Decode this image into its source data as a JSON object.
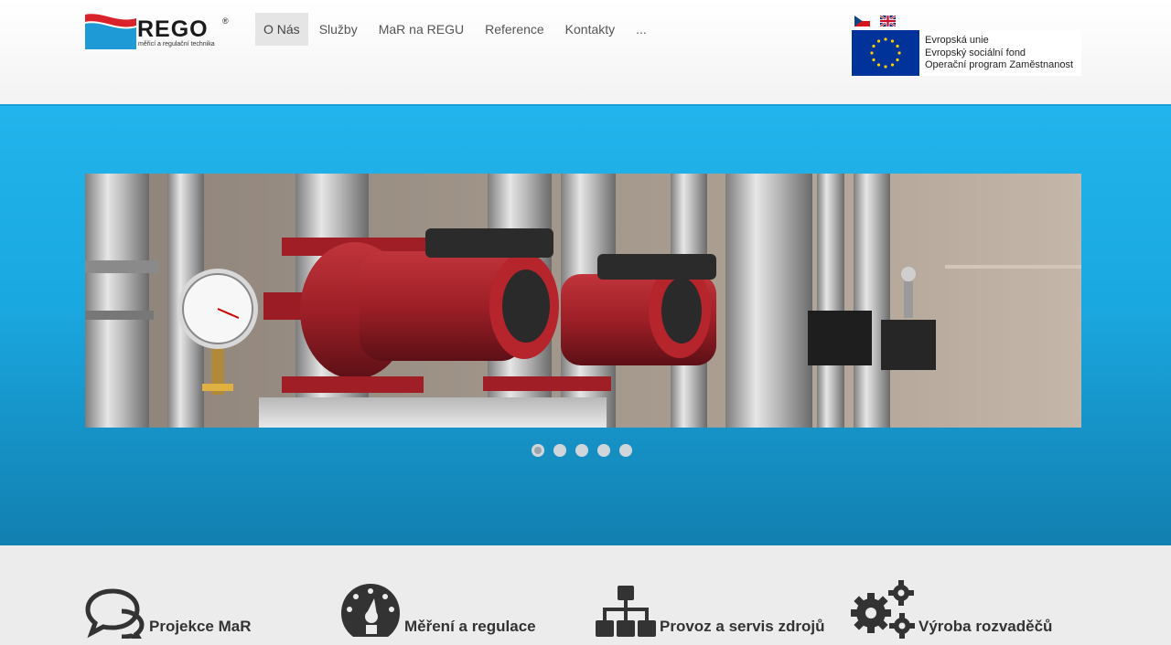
{
  "brand": {
    "name": "REGO",
    "registered": "®",
    "tagline": "měřicí a regulační technika",
    "colors": {
      "red": "#d9222a",
      "blue": "#1e9ad6"
    }
  },
  "nav": {
    "items": [
      {
        "label": "O Nás",
        "active": true
      },
      {
        "label": "Služby"
      },
      {
        "label": "MaR na REGU"
      },
      {
        "label": "Reference"
      },
      {
        "label": "Kontakty"
      },
      {
        "label": "..."
      }
    ]
  },
  "languages": [
    {
      "code": "cs",
      "icon": "czech-flag-icon"
    },
    {
      "code": "en",
      "icon": "uk-flag-icon"
    }
  ],
  "eu": {
    "line1": "Evropská unie",
    "line2": "Evropský sociální fond",
    "line3": "Operační program Zaměstnanost",
    "color": "#003399"
  },
  "slider": {
    "slide_count": 5,
    "active_index": 0
  },
  "services": [
    {
      "label": "Projekce MaR",
      "icon": "speech-bubbles-icon"
    },
    {
      "label": "Měření a regulace",
      "icon": "gauge-icon"
    },
    {
      "label": "Provoz a servis zdrojů",
      "icon": "sitemap-icon"
    },
    {
      "label": "Výroba rozvaděčů",
      "icon": "gears-icon"
    }
  ]
}
